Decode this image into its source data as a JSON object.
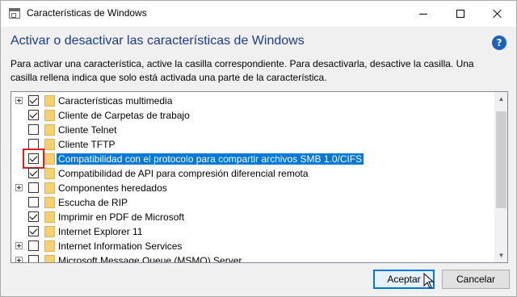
{
  "window": {
    "title": "Características de Windows"
  },
  "header": {
    "heading": "Activar o desactivar las características de Windows",
    "help_symbol": "?",
    "description": "Para activar una característica, active la casilla correspondiente. Para desactivarla, desactive la casilla. Una casilla rellena indica que solo está activada una parte de la característica."
  },
  "features": [
    {
      "label": "Características multimedia",
      "checked": true,
      "expandable": true,
      "selected": false
    },
    {
      "label": "Cliente de Carpetas de trabajo",
      "checked": true,
      "expandable": false,
      "selected": false
    },
    {
      "label": "Cliente Telnet",
      "checked": false,
      "expandable": false,
      "selected": false
    },
    {
      "label": "Cliente TFTP",
      "checked": false,
      "expandable": false,
      "selected": false
    },
    {
      "label": "Compatibilidad con el protocolo para compartir archivos SMB 1.0/CIFS",
      "checked": true,
      "expandable": false,
      "selected": true
    },
    {
      "label": "Compatibilidad de API para compresión diferencial remota",
      "checked": true,
      "expandable": false,
      "selected": false
    },
    {
      "label": "Componentes heredados",
      "checked": false,
      "expandable": true,
      "selected": false
    },
    {
      "label": "Escucha de RIP",
      "checked": false,
      "expandable": false,
      "selected": false
    },
    {
      "label": "Imprimir en PDF de Microsoft",
      "checked": true,
      "expandable": false,
      "selected": false
    },
    {
      "label": "Internet Explorer 11",
      "checked": true,
      "expandable": false,
      "selected": false
    },
    {
      "label": "Internet Information Services",
      "checked": false,
      "expandable": true,
      "selected": false
    },
    {
      "label": "Microsoft Message Queue (MSMQ) Server",
      "checked": false,
      "expandable": true,
      "selected": false
    }
  ],
  "buttons": {
    "ok_label": "Aceptar",
    "cancel_label": "Cancelar"
  },
  "colors": {
    "heading": "#1c3d8c",
    "selection": "#0078d7",
    "highlight_box": "#e02020",
    "help_icon": "#1a63b8"
  }
}
